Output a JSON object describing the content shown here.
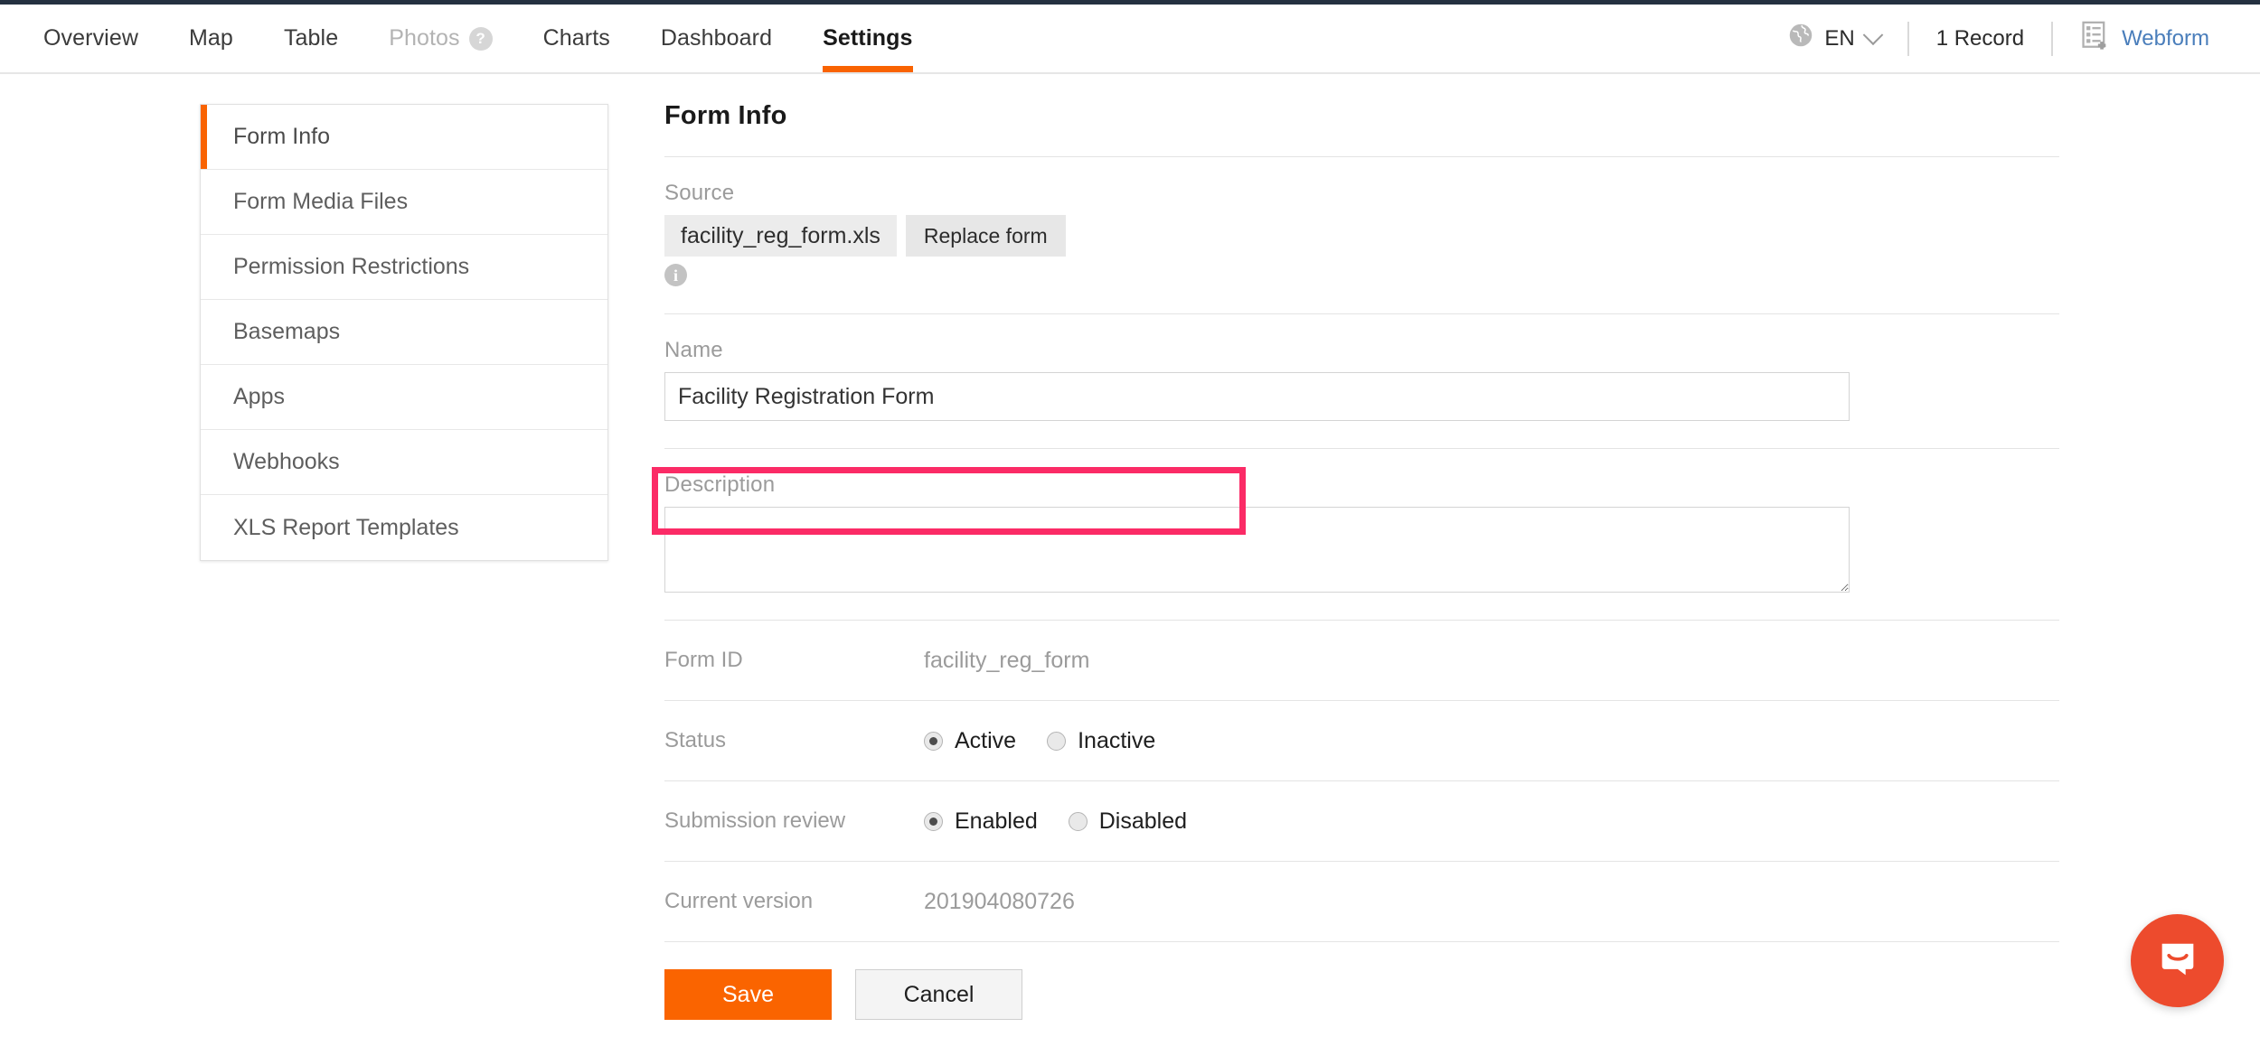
{
  "header": {
    "tabs": [
      {
        "label": "Overview",
        "state": "normal",
        "badge": null
      },
      {
        "label": "Map",
        "state": "normal",
        "badge": null
      },
      {
        "label": "Table",
        "state": "normal",
        "badge": null
      },
      {
        "label": "Photos",
        "state": "disabled",
        "badge": "?"
      },
      {
        "label": "Charts",
        "state": "normal",
        "badge": null
      },
      {
        "label": "Dashboard",
        "state": "normal",
        "badge": null
      },
      {
        "label": "Settings",
        "state": "active",
        "badge": null
      }
    ],
    "language": "EN",
    "language_icon": "globe-icon",
    "language_chevron": "chevron-down-icon",
    "record_count": "1 Record",
    "webform_label": "Webform",
    "webform_icon": "webform-add-icon"
  },
  "sidebar": {
    "items": [
      {
        "label": "Form Info",
        "active": true
      },
      {
        "label": "Form Media Files",
        "active": false
      },
      {
        "label": "Permission Restrictions",
        "active": false
      },
      {
        "label": "Basemaps",
        "active": false
      },
      {
        "label": "Apps",
        "active": false
      },
      {
        "label": "Webhooks",
        "active": false
      },
      {
        "label": "XLS Report Templates",
        "active": false
      }
    ]
  },
  "main": {
    "title": "Form Info",
    "source": {
      "label": "Source",
      "file_name": "facility_reg_form.xls",
      "replace_button": "Replace form",
      "info_icon": "info-icon",
      "info_glyph": "i"
    },
    "name": {
      "label": "Name",
      "value": "Facility Registration Form",
      "placeholder": ""
    },
    "description": {
      "label": "Description",
      "value": "",
      "placeholder": ""
    },
    "form_id": {
      "label": "Form ID",
      "value": "facility_reg_form"
    },
    "status": {
      "label": "Status",
      "options": [
        {
          "label": "Active",
          "selected": true
        },
        {
          "label": "Inactive",
          "selected": false
        }
      ]
    },
    "submission_review": {
      "label": "Submission review",
      "highlighted": true,
      "options": [
        {
          "label": "Enabled",
          "selected": true
        },
        {
          "label": "Disabled",
          "selected": false
        }
      ]
    },
    "current_version": {
      "label": "Current version",
      "value": "201904080726"
    },
    "actions": {
      "save_label": "Save",
      "cancel_label": "Cancel"
    }
  },
  "widgets": {
    "intercom_launcher": "chat-bubble-icon"
  },
  "colors": {
    "accent_orange": "#fa6400",
    "tab_underline": "#f96302",
    "highlight_pink": "#fb2b66",
    "link_blue": "#4a7ebb",
    "intercom_red": "#ed4b2d",
    "label_grey": "#9b9b9b",
    "top_strip": "#243140"
  }
}
